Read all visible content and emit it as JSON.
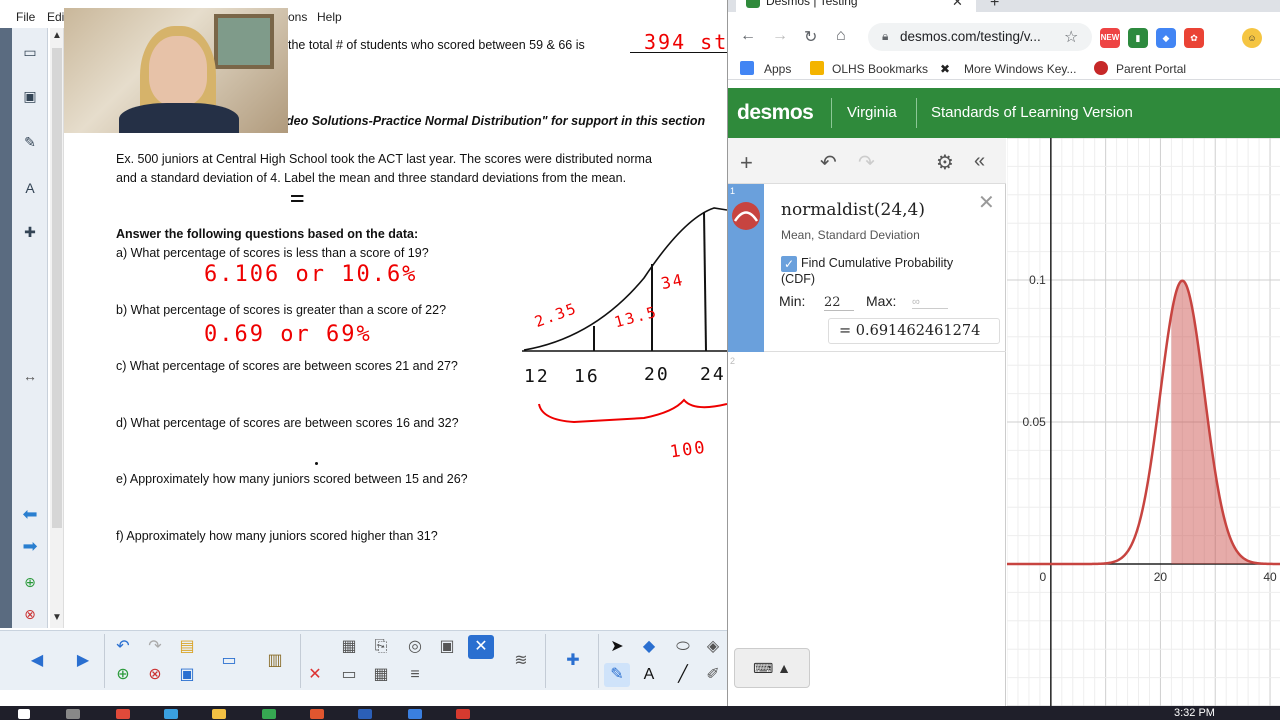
{
  "menu": {
    "file": "File",
    "edit": "Edi",
    "options": "ons",
    "help": "Help"
  },
  "doc": {
    "line1_prefix": "the total # of students who scored between 59 & 66 is",
    "line1_answer": "394 st",
    "video_note": "deo Solutions-Practice Normal Distribution\" for support in this section",
    "example_line1": "Ex.  500 juniors at Central High School took the ACT last year.  The scores were distributed norma",
    "example_line2": "and a standard deviation of 4.  Label the mean and three standard deviations from the mean.",
    "equals_mark": "=",
    "answer_header": "Answer the following questions based on the data:",
    "questions": [
      "a)  What percentage of scores is less than a score of 19?",
      "b)  What percentage of scores is greater than a score of 22?",
      "c)  What percentage of scores are between scores 21 and 27?",
      "d)  What percentage of scores are between scores 16 and 32?",
      "e)  Approximately how many juniors scored between 15 and 26?",
      "f)  Approximately how many juniors scored higher than 31?"
    ],
    "answer_a": "6.106 or 10.6%",
    "answer_b": "0.69 or 69%",
    "curve_labels": {
      "p235": "2.35",
      "p135": "13.5",
      "p34": "34",
      "x12": "12",
      "x16": "16",
      "x20": "20",
      "x24": "24",
      "total": "100"
    }
  },
  "browser": {
    "tab_title": "Desmos | Testing",
    "tab_close": "✕",
    "new_tab": "+",
    "url": "desmos.com/testing/v...",
    "bookmarks": [
      "Apps",
      "OLHS Bookmarks",
      "More Windows Key...",
      "Parent Portal"
    ],
    "ext_new": "NEW"
  },
  "desmos": {
    "logo": "desmos",
    "state": "Virginia",
    "version": "Standards of Learning Version",
    "expr_index_1": "1",
    "expr_index_2": "2",
    "formula": "normaldist(24,4)",
    "params": "Mean,  Standard Deviation",
    "cdf_label_1": "Find Cumulative Probability",
    "cdf_label_2": "(CDF)",
    "min_label": "Min:",
    "min_value": "22",
    "max_label": "Max:",
    "max_value": "∞",
    "result": "=  0.691462461274",
    "keyboard": "⌨ ▲"
  },
  "graph": {
    "y_ticks": [
      "0.1",
      "0.05"
    ],
    "x_ticks": [
      "0",
      "20",
      "40"
    ],
    "mean": 24,
    "sd": 4,
    "cdf_min": 22,
    "xlim": [
      -8,
      42
    ],
    "ylim": [
      -0.05,
      0.15
    ]
  },
  "taskbar": {
    "clock": "3:32 PM"
  }
}
